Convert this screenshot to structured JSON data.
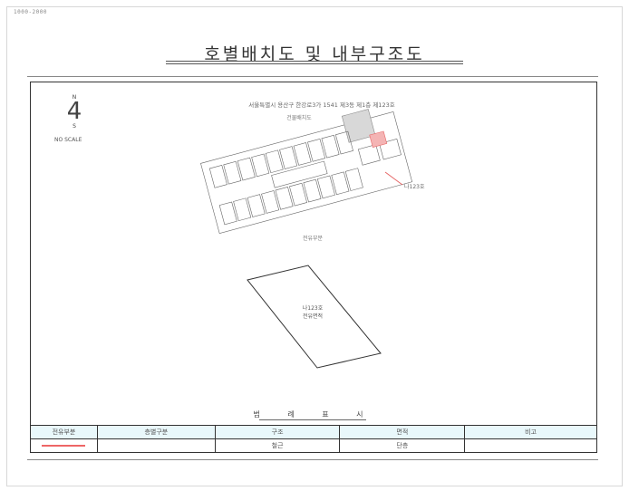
{
  "header": {
    "doc_id": "1000-2000",
    "title": "호별배치도 및 내부구조도"
  },
  "layout": {
    "north_n": "N",
    "north_number": "4",
    "north_s": "S",
    "scale": "NO SCALE",
    "site_title": "서울특별시 용산구 한강로3가 1541 제3동 제1층 제123호",
    "site_subtitle": "건물배치도",
    "unit_label_site": "나123호",
    "unit_subtitle": "전유부분",
    "unit_label": "나123호",
    "unit_area_label": "전유면적"
  },
  "legend": {
    "title": "범 례 표 시",
    "headers": [
      "전유부분",
      "층별구분",
      "구조",
      "면적",
      "비고"
    ],
    "row": [
      "",
      "",
      "철근",
      "단층",
      ""
    ]
  },
  "colors": {
    "highlight": "#e66666",
    "legend_header_bg": "#e9f8fb",
    "frame": "#333333"
  }
}
